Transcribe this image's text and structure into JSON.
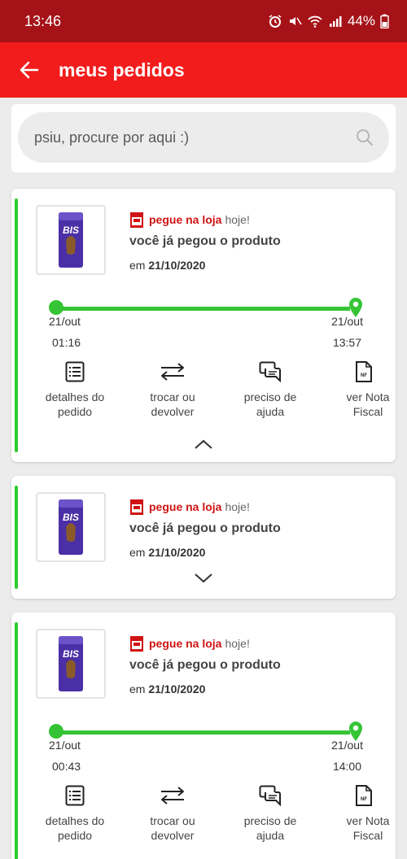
{
  "status_bar": {
    "time": "13:46",
    "battery": "44%"
  },
  "header": {
    "title": "meus pedidos"
  },
  "search": {
    "placeholder": "psiu, procure por aqui :)"
  },
  "orders": [
    {
      "pickup_label": "pegue na loja",
      "pickup_when": "hoje!",
      "status": "você já pegou o produto",
      "date_prefix": "em",
      "date": "21/10/2020",
      "expanded": true,
      "timeline": {
        "start_date": "21/out",
        "start_time": "01:16",
        "end_date": "21/out",
        "end_time": "13:57"
      },
      "actions": [
        {
          "label1": "detalhes do",
          "label2": "pedido",
          "icon": "list-icon"
        },
        {
          "label1": "trocar ou",
          "label2": "devolver",
          "icon": "swap-arrows-icon"
        },
        {
          "label1": "preciso de",
          "label2": "ajuda",
          "icon": "chat-icon"
        },
        {
          "label1": "ver Nota",
          "label2": "Fiscal",
          "icon": "invoice-icon"
        }
      ]
    },
    {
      "pickup_label": "pegue na loja",
      "pickup_when": "hoje!",
      "status": "você já pegou o produto",
      "date_prefix": "em",
      "date": "21/10/2020",
      "expanded": false
    },
    {
      "pickup_label": "pegue na loja",
      "pickup_when": "hoje!",
      "status": "você já pegou o produto",
      "date_prefix": "em",
      "date": "21/10/2020",
      "expanded": true,
      "timeline": {
        "start_date": "21/out",
        "start_time": "00:43",
        "end_date": "21/out",
        "end_time": "14:00"
      },
      "actions": [
        {
          "label1": "detalhes do",
          "label2": "pedido",
          "icon": "list-icon"
        },
        {
          "label1": "trocar ou",
          "label2": "devolver",
          "icon": "swap-arrows-icon"
        },
        {
          "label1": "preciso de",
          "label2": "ajuda",
          "icon": "chat-icon"
        },
        {
          "label1": "ver Nota",
          "label2": "Fiscal",
          "icon": "invoice-icon"
        }
      ]
    }
  ],
  "product": {
    "name": "BIS"
  },
  "colors": {
    "primary": "#f21c1c",
    "status_bar": "#a51218",
    "accent_green": "#35c435"
  }
}
